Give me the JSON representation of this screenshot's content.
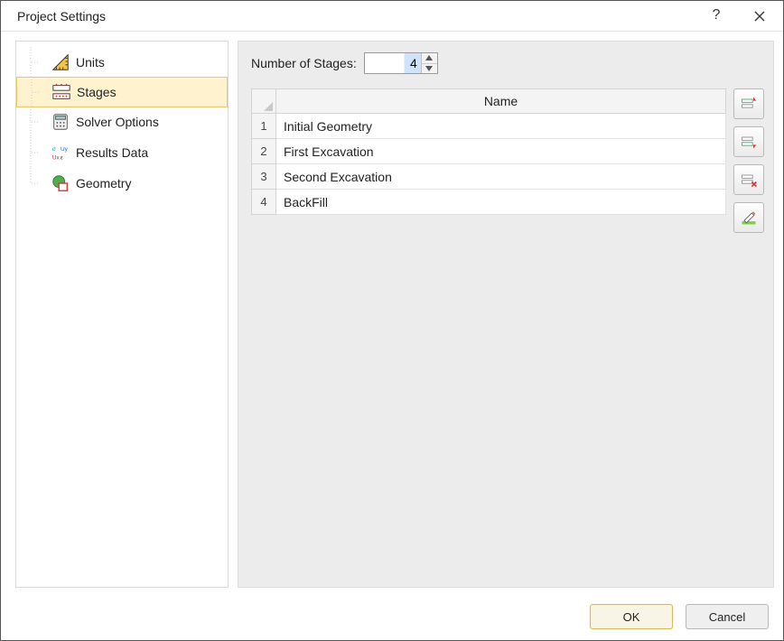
{
  "window": {
    "title": "Project Settings"
  },
  "sidebar": {
    "items": [
      {
        "label": "Units"
      },
      {
        "label": "Stages"
      },
      {
        "label": "Solver Options"
      },
      {
        "label": "Results Data"
      },
      {
        "label": "Geometry"
      }
    ],
    "selected_index": 1
  },
  "main": {
    "num_stages_label": "Number of Stages:",
    "num_stages_value": "4",
    "table": {
      "column_header": "Name",
      "rows": [
        {
          "num": "1",
          "name": "Initial Geometry"
        },
        {
          "num": "2",
          "name": "First Excavation"
        },
        {
          "num": "3",
          "name": "Second Excavation"
        },
        {
          "num": "4",
          "name": "BackFill"
        }
      ]
    },
    "toolbar_icons": [
      "insert-before-icon",
      "insert-after-icon",
      "delete-stage-icon",
      "edit-stage-icon"
    ]
  },
  "footer": {
    "ok_label": "OK",
    "cancel_label": "Cancel"
  }
}
